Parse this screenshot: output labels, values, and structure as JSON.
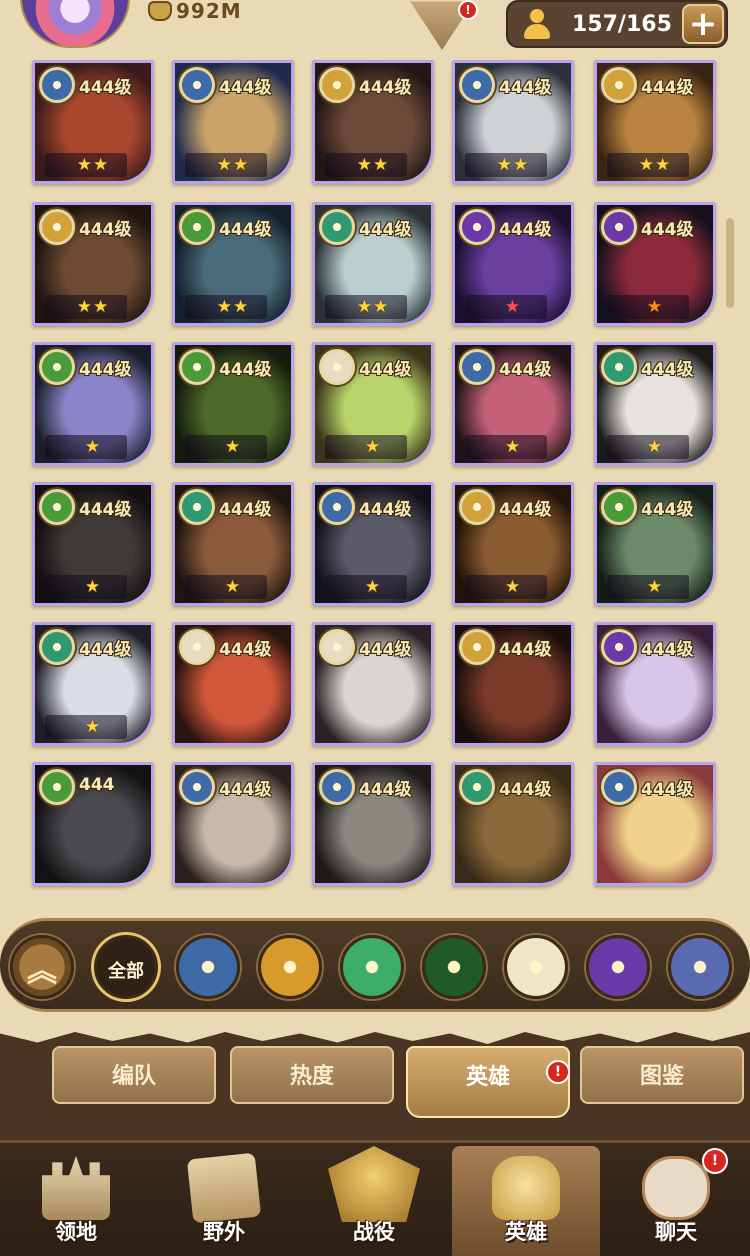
{
  "top": {
    "power_value": "992M",
    "hero_count": "157/165",
    "add_label": "+",
    "alert": "!"
  },
  "heroes": [
    {
      "faction": "blue",
      "level": "444级",
      "stars": "★★",
      "star_color": "gold",
      "portrait": [
        "#a8472e",
        "#3a1b1c"
      ]
    },
    {
      "faction": "blue",
      "level": "444级",
      "stars": "★★",
      "star_color": "gold",
      "portrait": [
        "#c9a36a",
        "#1e2b4a"
      ]
    },
    {
      "faction": "gold",
      "level": "444级",
      "stars": "★★",
      "star_color": "gold",
      "portrait": [
        "#6b4a3a",
        "#231614"
      ]
    },
    {
      "faction": "blue",
      "level": "444级",
      "stars": "★★",
      "star_color": "gold",
      "portrait": [
        "#cfd3d6",
        "#2a2f3b"
      ]
    },
    {
      "faction": "gold",
      "level": "444级",
      "stars": "★★",
      "star_color": "gold",
      "portrait": [
        "#b88440",
        "#3a2414"
      ]
    },
    {
      "faction": "gold",
      "level": "444级",
      "stars": "★★",
      "star_color": "gold",
      "portrait": [
        "#6d4a32",
        "#1f1410"
      ]
    },
    {
      "faction": "green",
      "level": "444级",
      "stars": "★★",
      "star_color": "gold",
      "portrait": [
        "#4a6b7a",
        "#14202a"
      ]
    },
    {
      "faction": "teal",
      "level": "444级",
      "stars": "★★",
      "star_color": "gold",
      "portrait": [
        "#b9d0cf",
        "#2a3236"
      ]
    },
    {
      "faction": "purple",
      "level": "444级",
      "stars": "★",
      "star_color": "red",
      "portrait": [
        "#6a3fa0",
        "#1c1030"
      ]
    },
    {
      "faction": "purple",
      "level": "444级",
      "stars": "★",
      "star_color": "orange",
      "portrait": [
        "#8a2a3a",
        "#15101e"
      ]
    },
    {
      "faction": "green",
      "level": "444级",
      "stars": "★",
      "star_color": "gold",
      "portrait": [
        "#8b84c8",
        "#1a1e2c"
      ]
    },
    {
      "faction": "green",
      "level": "444级",
      "stars": "★",
      "star_color": "gold",
      "portrait": [
        "#4d6a2a",
        "#141a0c"
      ]
    },
    {
      "faction": "white",
      "level": "444级",
      "stars": "★",
      "star_color": "gold",
      "portrait": [
        "#b9d46a",
        "#3a3418"
      ]
    },
    {
      "faction": "blue",
      "level": "444级",
      "stars": "★",
      "star_color": "gold",
      "portrait": [
        "#c4607a",
        "#201418"
      ]
    },
    {
      "faction": "teal",
      "level": "444级",
      "stars": "★",
      "star_color": "gold",
      "portrait": [
        "#e6e2de",
        "#1c1a1a"
      ]
    },
    {
      "faction": "green",
      "level": "444级",
      "stars": "★",
      "star_color": "gold",
      "portrait": [
        "#3e3a38",
        "#121010"
      ]
    },
    {
      "faction": "teal",
      "level": "444级",
      "stars": "★",
      "star_color": "gold",
      "portrait": [
        "#8a5a3a",
        "#1e1410"
      ]
    },
    {
      "faction": "blue",
      "level": "444级",
      "stars": "★",
      "star_color": "gold",
      "portrait": [
        "#5a5a68",
        "#12121a"
      ]
    },
    {
      "faction": "gold",
      "level": "444级",
      "stars": "★",
      "star_color": "gold",
      "portrait": [
        "#8a5a30",
        "#221408"
      ]
    },
    {
      "faction": "green",
      "level": "444级",
      "stars": "★",
      "star_color": "gold",
      "portrait": [
        "#6a8a6a",
        "#141c16"
      ]
    },
    {
      "faction": "teal",
      "level": "444级",
      "stars": "★",
      "star_color": "gold",
      "portrait": [
        "#dadde4",
        "#1e1e28"
      ]
    },
    {
      "faction": "white",
      "level": "444级",
      "stars": "",
      "star_color": "gold",
      "portrait": [
        "#d0573a",
        "#2a1410"
      ]
    },
    {
      "faction": "white",
      "level": "444级",
      "stars": "",
      "star_color": "gold",
      "portrait": [
        "#d9d6d2",
        "#2a2224"
      ]
    },
    {
      "faction": "gold",
      "level": "444级",
      "stars": "",
      "star_color": "gold",
      "portrait": [
        "#7a3a2a",
        "#1a0e0c"
      ]
    },
    {
      "faction": "purple",
      "level": "444级",
      "stars": "",
      "star_color": "gold",
      "portrait": [
        "#d8c6e8",
        "#3a1e3a"
      ]
    },
    {
      "faction": "green",
      "level": "444",
      "stars": "",
      "star_color": "gold",
      "portrait": [
        "#4a4a4e",
        "#121214"
      ]
    },
    {
      "faction": "blue",
      "level": "444级",
      "stars": "",
      "star_color": "gold",
      "portrait": [
        "#c8b8a8",
        "#2a201e"
      ]
    },
    {
      "faction": "blue",
      "level": "444级",
      "stars": "",
      "star_color": "gold",
      "portrait": [
        "#8a8680",
        "#1e1a18"
      ]
    },
    {
      "faction": "teal",
      "level": "444级",
      "stars": "",
      "star_color": "gold",
      "portrait": [
        "#8a6a3a",
        "#3a2a18"
      ]
    },
    {
      "faction": "blue",
      "level": "444级",
      "stars": "",
      "star_color": "gold",
      "portrait": [
        "#f0d28a",
        "#8a3a3a"
      ]
    }
  ],
  "filters": [
    {
      "name": "collapse-filter-button"
    },
    {
      "name": "filter-all-button",
      "label": "全部"
    },
    {
      "name": "faction-lightbearer-filter",
      "color": "#3f6aa8"
    },
    {
      "name": "faction-mauler-filter",
      "color": "#d89a2a"
    },
    {
      "name": "faction-wilder-filter",
      "color": "#3cae6a"
    },
    {
      "name": "faction-graveborn-filter",
      "color": "#1f5a28"
    },
    {
      "name": "faction-celestial-filter",
      "color": "#f2e6c8"
    },
    {
      "name": "faction-hypogean-filter",
      "color": "#6b3aa8"
    },
    {
      "name": "faction-dimensional-filter",
      "color": "#5a6ab0"
    }
  ],
  "tabs": [
    "编队",
    "热度",
    "英雄",
    "图鉴"
  ],
  "nav": [
    "领地",
    "野外",
    "战役",
    "英雄",
    "聊天"
  ],
  "colors": {
    "gold": "#d3a13a",
    "blue": "#3f6aa8",
    "green": "#4a9a3a",
    "teal": "#2f9a72",
    "purple": "#6b3aa8",
    "white": "#e8dcc0",
    "badge_red": "#d7261e"
  }
}
